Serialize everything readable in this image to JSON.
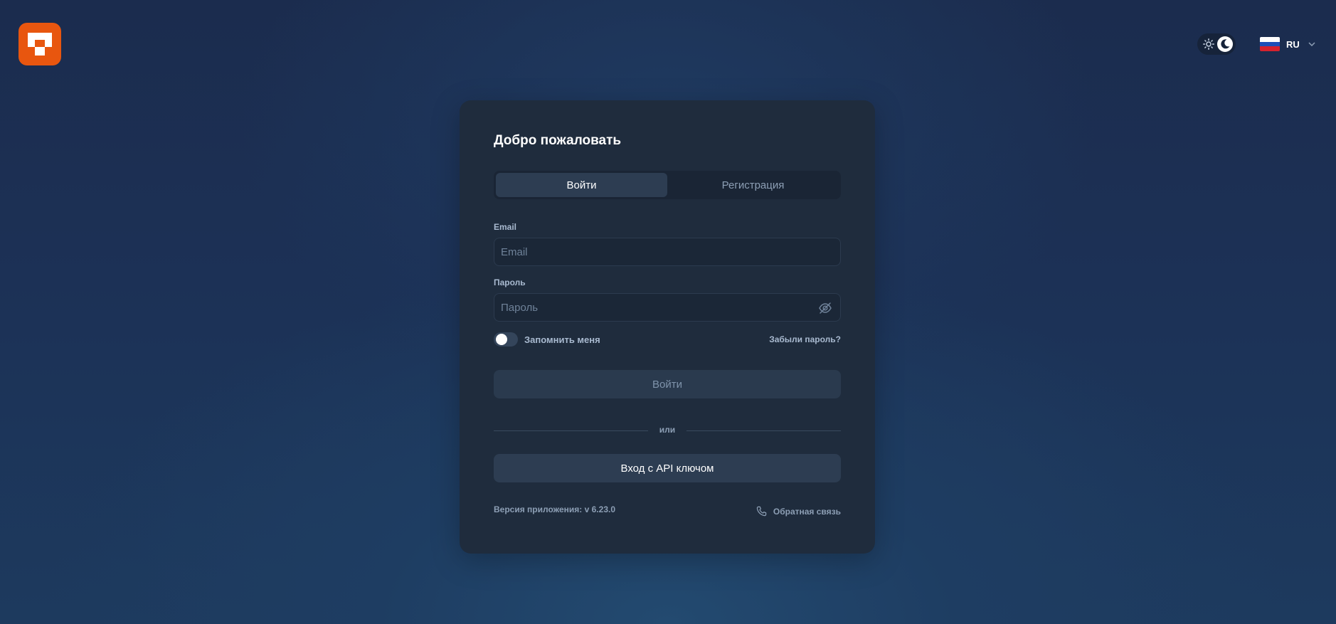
{
  "theme": {
    "modes": [
      "light",
      "dark"
    ],
    "active": "dark"
  },
  "language": {
    "code": "RU",
    "flag": "russia-flag-icon"
  },
  "colors": {
    "brand": "#e8560f",
    "card_bg": "#1f2c3d",
    "page_bg": "#1c3156"
  },
  "card": {
    "title": "Добро пожаловать",
    "tabs": [
      {
        "label": "Войти",
        "active": true
      },
      {
        "label": "Регистрация",
        "active": false
      }
    ],
    "email": {
      "label": "Email",
      "placeholder": "Email",
      "value": ""
    },
    "password": {
      "label": "Пароль",
      "placeholder": "Пароль",
      "value": ""
    },
    "remember": {
      "label": "Запомнить меня",
      "checked": false
    },
    "forgot_label": "Забыли пароль?",
    "login_button": "Войти",
    "divider_text": "или",
    "api_button": "Вход с API ключом",
    "version_text": "Версия приложения: v 6.23.0",
    "feedback_label": "Обратная связь"
  }
}
